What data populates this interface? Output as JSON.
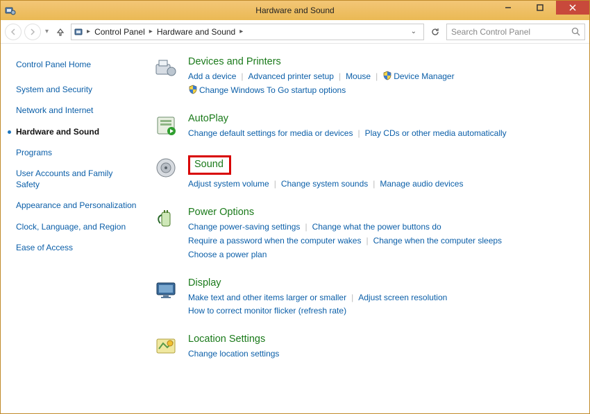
{
  "window": {
    "title": "Hardware and Sound"
  },
  "breadcrumb": {
    "root_icon": "control-panel-icon",
    "items": [
      "Control Panel",
      "Hardware and Sound"
    ]
  },
  "search": {
    "placeholder": "Search Control Panel"
  },
  "sidebar": {
    "home": "Control Panel Home",
    "items": [
      {
        "label": "System and Security",
        "active": false
      },
      {
        "label": "Network and Internet",
        "active": false
      },
      {
        "label": "Hardware and Sound",
        "active": true
      },
      {
        "label": "Programs",
        "active": false
      },
      {
        "label": "User Accounts and Family Safety",
        "active": false
      },
      {
        "label": "Appearance and Personalization",
        "active": false
      },
      {
        "label": "Clock, Language, and Region",
        "active": false
      },
      {
        "label": "Ease of Access",
        "active": false
      }
    ]
  },
  "categories": [
    {
      "title": "Devices and Printers",
      "links": [
        {
          "label": "Add a device"
        },
        {
          "label": "Advanced printer setup"
        },
        {
          "label": "Mouse"
        },
        {
          "label": "Device Manager",
          "shield": true
        },
        {
          "label": "Change Windows To Go startup options",
          "shield": true,
          "newline": true
        }
      ]
    },
    {
      "title": "AutoPlay",
      "links": [
        {
          "label": "Change default settings for media or devices"
        },
        {
          "label": "Play CDs or other media automatically"
        }
      ]
    },
    {
      "title": "Sound",
      "highlight": true,
      "links": [
        {
          "label": "Adjust system volume"
        },
        {
          "label": "Change system sounds"
        },
        {
          "label": "Manage audio devices"
        }
      ]
    },
    {
      "title": "Power Options",
      "links": [
        {
          "label": "Change power-saving settings"
        },
        {
          "label": "Change what the power buttons do"
        },
        {
          "label": "Require a password when the computer wakes",
          "newline": true
        },
        {
          "label": "Change when the computer sleeps"
        },
        {
          "label": "Choose a power plan",
          "newline": true
        }
      ]
    },
    {
      "title": "Display",
      "links": [
        {
          "label": "Make text and other items larger or smaller"
        },
        {
          "label": "Adjust screen resolution"
        },
        {
          "label": "How to correct monitor flicker (refresh rate)",
          "newline": true
        }
      ]
    },
    {
      "title": "Location Settings",
      "links": [
        {
          "label": "Change location settings"
        }
      ]
    }
  ]
}
